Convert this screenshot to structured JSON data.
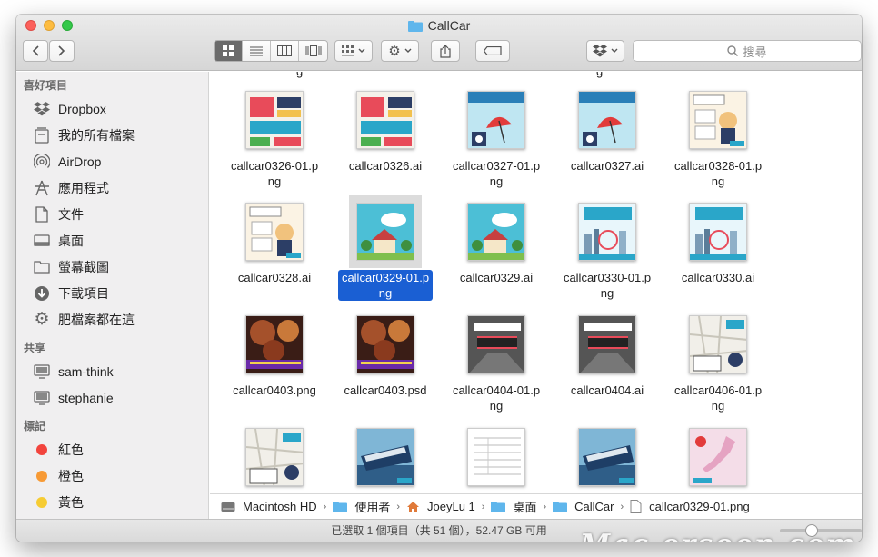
{
  "window": {
    "title": "CallCar"
  },
  "toolbar": {
    "search_placeholder": "搜尋"
  },
  "sidebar": {
    "favorites_header": "喜好項目",
    "favorites": [
      {
        "label": "Dropbox",
        "icon": "dropbox-icon"
      },
      {
        "label": "我的所有檔案",
        "icon": "all-files-icon"
      },
      {
        "label": "AirDrop",
        "icon": "airdrop-icon"
      },
      {
        "label": "應用程式",
        "icon": "applications-icon"
      },
      {
        "label": "文件",
        "icon": "documents-icon"
      },
      {
        "label": "桌面",
        "icon": "desktop-icon"
      },
      {
        "label": "螢幕截圖",
        "icon": "folder-icon"
      },
      {
        "label": "下載項目",
        "icon": "downloads-icon"
      },
      {
        "label": "肥檔案都在這",
        "icon": "gear-icon"
      }
    ],
    "shared_header": "共享",
    "shared": [
      {
        "label": "sam-think",
        "icon": "computer-icon"
      },
      {
        "label": "stephanie",
        "icon": "computer-icon"
      }
    ],
    "tags_header": "標記",
    "tags": [
      {
        "label": "紅色",
        "color": "#f2443d"
      },
      {
        "label": "橙色",
        "color": "#f79a35"
      },
      {
        "label": "黃色",
        "color": "#f6cc33"
      }
    ]
  },
  "files": [
    {
      "name": "callcar0326-01.png",
      "thumb": "infographic",
      "selected": false
    },
    {
      "name": "callcar0326.ai",
      "thumb": "infographic",
      "selected": false
    },
    {
      "name": "callcar0327-01.png",
      "thumb": "umbrella",
      "selected": false
    },
    {
      "name": "callcar0327.ai",
      "thumb": "umbrella",
      "selected": false
    },
    {
      "name": "callcar0328-01.png",
      "thumb": "question",
      "selected": false
    },
    {
      "name": "callcar0328.ai",
      "thumb": "question",
      "selected": false
    },
    {
      "name": "callcar0329-01.png",
      "thumb": "house",
      "selected": true
    },
    {
      "name": "callcar0329.ai",
      "thumb": "house",
      "selected": false
    },
    {
      "name": "callcar0330-01.png",
      "thumb": "city",
      "selected": false
    },
    {
      "name": "callcar0330.ai",
      "thumb": "city",
      "selected": false
    },
    {
      "name": "callcar0403.png",
      "thumb": "food",
      "selected": false
    },
    {
      "name": "callcar0403.psd",
      "thumb": "food",
      "selected": false
    },
    {
      "name": "callcar0404-01.png",
      "thumb": "street",
      "selected": false
    },
    {
      "name": "callcar0404.ai",
      "thumb": "street",
      "selected": false
    },
    {
      "name": "callcar0406-01.png",
      "thumb": "map",
      "selected": false
    },
    {
      "name": "",
      "thumb": "map",
      "selected": false
    },
    {
      "name": "",
      "thumb": "boat",
      "selected": false
    },
    {
      "name": "",
      "thumb": "document",
      "selected": false
    },
    {
      "name": "",
      "thumb": "boat",
      "selected": false
    },
    {
      "name": "",
      "thumb": "japan",
      "selected": false
    }
  ],
  "pathbar": [
    {
      "label": "Macintosh HD",
      "icon": "hard-disk-icon"
    },
    {
      "label": "使用者",
      "icon": "folder-icon"
    },
    {
      "label": "JoeyLu 1",
      "icon": "home-icon"
    },
    {
      "label": "桌面",
      "icon": "folder-icon"
    },
    {
      "label": "CallCar",
      "icon": "folder-icon"
    },
    {
      "label": "callcar0329-01.png",
      "icon": "file-icon"
    }
  ],
  "status": {
    "text": "已選取 1 個項目（共 51 個），52.47 GB 可用"
  },
  "watermark": "Mac.orsoon.com",
  "colors": {
    "selection": "#1a5fd3",
    "accent_teal": "#2aa6c9"
  }
}
